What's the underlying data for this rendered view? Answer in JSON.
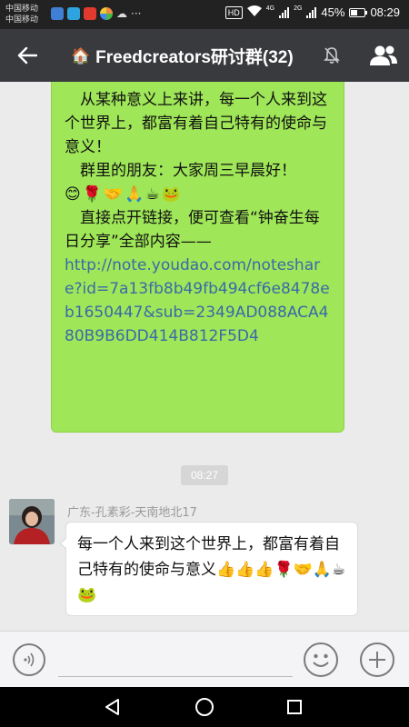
{
  "status_bar": {
    "carrier_1": "中国移动",
    "carrier_2": "中国移动",
    "hd": "HD",
    "net_1": "4G",
    "net_2": "2G",
    "battery_text": "45%",
    "battery_level": 0.45,
    "time": "08:29",
    "notification_icons": [
      "app-icon-blue",
      "telegram-icon",
      "news-icon",
      "colorful-app-icon",
      "cloud-icon"
    ]
  },
  "header": {
    "group_icon": "house-icon",
    "title": "Freedcreators研讨群(32)",
    "muted": true
  },
  "messages": {
    "outgoing": {
      "para_1": "从某种意义上来讲，每一个人来到这个世界上，都富有着自己特有的使命与意义！",
      "para_2": "群里的朋友：大家周三早晨好！",
      "emoji_row": "😊🌹🤝🙏☕🐸",
      "para_3": "直接点开链接，便可查看“钟奋生每日分享”全部内容——",
      "link": "http://note.youdao.com/noteshare?id=7a13fb8b49fb494cf6e8478eb1650447&sub=2349AD088ACA480B9B6DD414B812F5D4"
    },
    "timestamp": "08:27",
    "incoming": {
      "sender": "广东-孔素彩-天南地北17",
      "text": "每一个人来到这个世界上，都富有着自己特有的使命与意义👍👍👍🌹🤝🙏☕🐸"
    }
  },
  "input": {
    "placeholder": ""
  },
  "colors": {
    "title_bar": "#393a3e",
    "outgoing_bubble": "#9fe658",
    "chat_bg": "#ebebeb",
    "link": "#3a6aa8"
  }
}
